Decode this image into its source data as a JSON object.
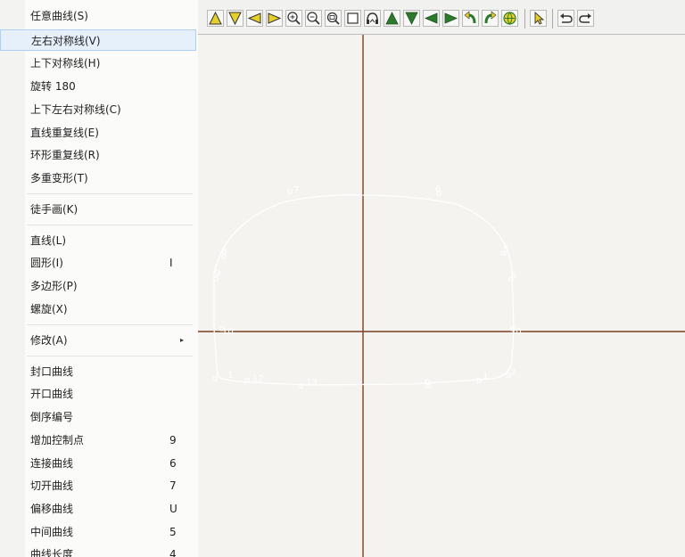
{
  "menu": {
    "items": [
      {
        "label": "任意曲线(S)",
        "key": ""
      },
      {
        "label": "左右对称线(V)",
        "key": ""
      },
      {
        "label": "上下对称线(H)",
        "key": ""
      },
      {
        "label": "旋转 180",
        "key": ""
      },
      {
        "label": "上下左右对称线(C)",
        "key": ""
      },
      {
        "label": "直线重复线(E)",
        "key": ""
      },
      {
        "label": "环形重复线(R)",
        "key": ""
      },
      {
        "label": "多重变形(T)",
        "key": ""
      },
      {
        "label": "徒手画(K)",
        "key": ""
      },
      {
        "label": "直线(L)",
        "key": ""
      },
      {
        "label": "圆形(I)",
        "key": "I"
      },
      {
        "label": "多边形(P)",
        "key": ""
      },
      {
        "label": "螺旋(X)",
        "key": ""
      },
      {
        "label": "修改(A)",
        "key": ""
      },
      {
        "label": "封口曲线",
        "key": ""
      },
      {
        "label": "开口曲线",
        "key": ""
      },
      {
        "label": "倒序编号",
        "key": ""
      },
      {
        "label": "增加控制点",
        "key": "9"
      },
      {
        "label": "连接曲线",
        "key": "6"
      },
      {
        "label": "切开曲线",
        "key": "7"
      },
      {
        "label": "偏移曲线",
        "key": "U"
      },
      {
        "label": "中间曲线",
        "key": "5"
      },
      {
        "label": "曲线长度",
        "key": "4"
      }
    ],
    "highlighted": "左右对称线(V)",
    "submenu_arrow": "▸"
  },
  "toolbar": {
    "icons": [
      "triangle-up-icon",
      "triangle-down-icon",
      "triangle-left-icon",
      "triangle-right-icon",
      "zoom-in-icon",
      "zoom-out-icon",
      "zoom-fit-icon",
      "rectangle-icon",
      "headphones-icon",
      "arrow-up-icon",
      "arrow-down-icon",
      "arrow-left-icon",
      "arrow-right-icon",
      "rotate-left-icon",
      "rotate-right-icon",
      "globe-icon",
      "pointer-icon",
      "undo-icon",
      "redo-icon"
    ]
  },
  "canvas": {
    "point_labels": [
      "7",
      "6",
      "8",
      "5",
      "9",
      "5",
      "10",
      "10",
      "1",
      "12",
      "13",
      "0",
      "1",
      "2"
    ],
    "colors": {
      "axis": "#7a4020",
      "curve": "#ffffff",
      "toolbar_icon_fill": "#e6cf2a",
      "highlight": "#e6f0fa"
    }
  }
}
